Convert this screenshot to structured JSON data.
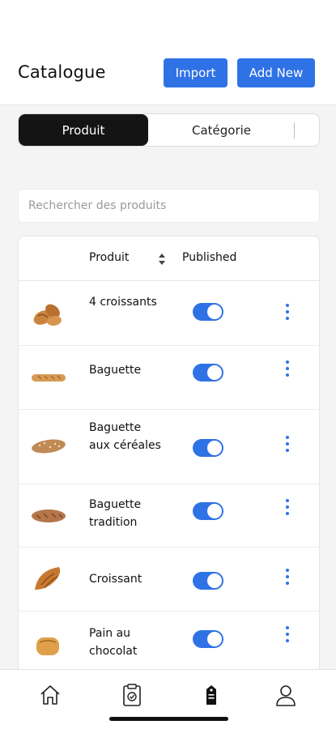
{
  "header": {
    "title": "Catalogue",
    "import_label": "Import",
    "add_new_label": "Add New"
  },
  "tabs": [
    {
      "label": "Produit",
      "active": true
    },
    {
      "label": "Catégorie",
      "active": false
    }
  ],
  "search": {
    "placeholder": "Rechercher des produits"
  },
  "table": {
    "columns": {
      "produit": "Produit",
      "published": "Published"
    },
    "rows": [
      {
        "name": "4 croissants",
        "published": true,
        "image_icon": "croissants-photo"
      },
      {
        "name": "Baguette",
        "published": true,
        "image_icon": "baguette-photo"
      },
      {
        "name": "Baguette aux céréales",
        "published": true,
        "image_icon": "cereal-baguette-photo"
      },
      {
        "name": "Baguette tradition",
        "published": true,
        "image_icon": "tradition-baguette-photo"
      },
      {
        "name": "Croissant",
        "published": true,
        "image_icon": "croissant-photo"
      },
      {
        "name": "Pain au chocolat",
        "published": true,
        "image_icon": "pain-au-chocolat-photo"
      }
    ]
  },
  "bottom_nav": {
    "items": [
      "home-icon",
      "clipboard-icon",
      "tag-icon",
      "user-icon"
    ],
    "active": "tag-icon"
  },
  "colors": {
    "accent": "#2f72e6",
    "active_tab": "#141414"
  }
}
